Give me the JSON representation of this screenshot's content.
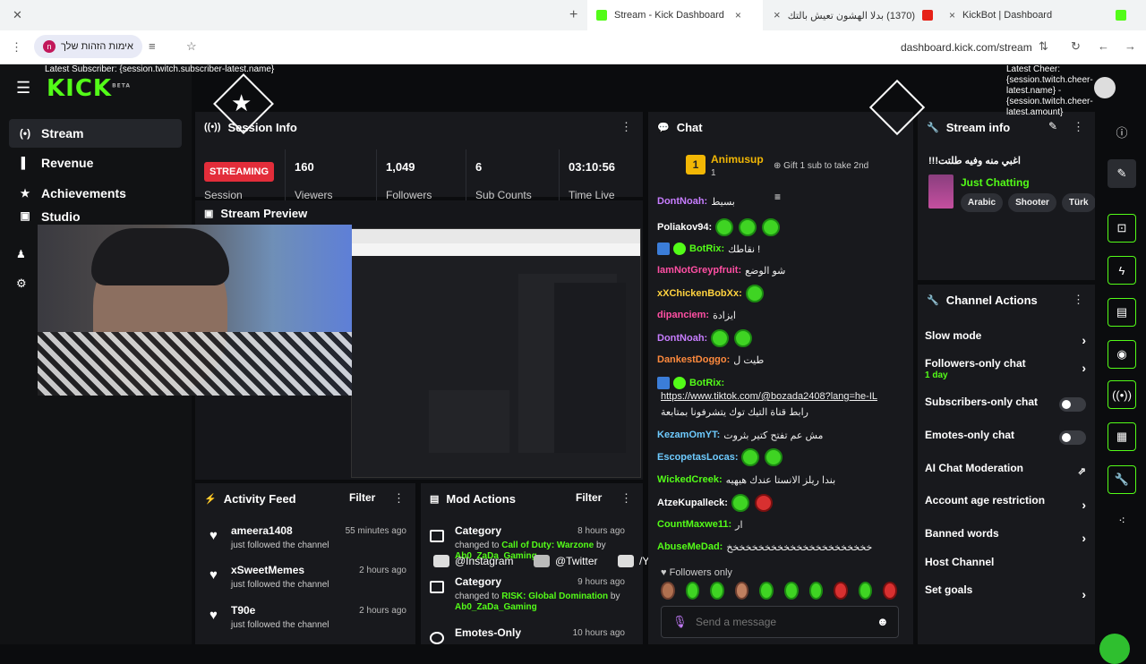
{
  "browser": {
    "tabs": [
      {
        "title": "",
        "close": "×"
      },
      {
        "title": "Stream - Kick Dashboard",
        "close": "×"
      },
      {
        "title": "(1370) بدلا الهشون تعيش بالتك",
        "close": "×"
      },
      {
        "title": "KickBot | Dashboard",
        "close": "×"
      }
    ],
    "new_tab": "+",
    "profile_label": "אימות הזהות שלך",
    "profile_initial": "n",
    "url": "dashboard.kick.com/stream"
  },
  "overlay": {
    "latest_subscriber": "Latest Subscriber: {session.twitch.subscriber-latest.name}",
    "latest_cheer": "Latest Cheer: {session.twitch.cheer-latest.name} - {session.twitch.cheer-latest.amount}",
    "socials": [
      "@Instagram",
      "@Twitter",
      "/YouTube"
    ]
  },
  "sidebar": {
    "logo": "KICK",
    "logo_beta": "BETA",
    "items": [
      {
        "label": "Stream",
        "icon": "stream-icon",
        "glyph": "(•)"
      },
      {
        "label": "Revenue",
        "icon": "revenue-icon",
        "glyph": "▌"
      },
      {
        "label": "Achievements",
        "icon": "trophy-icon",
        "glyph": "★"
      },
      {
        "label": "Studio",
        "icon": "studio-icon",
        "glyph": "▣"
      }
    ]
  },
  "session_info": {
    "title": "Session Info",
    "status": "STREAMING",
    "status_label": "Session",
    "stats": [
      {
        "value": "160",
        "label": "Viewers"
      },
      {
        "value": "1,049",
        "label": "Followers"
      },
      {
        "value": "6",
        "label": "Sub Counts"
      },
      {
        "value": "03:10:56",
        "label": "Time Live"
      }
    ]
  },
  "stream_preview": {
    "title": "Stream Preview"
  },
  "activity_feed": {
    "title": "Activity Feed",
    "filter": "Filter",
    "items": [
      {
        "user": "ameera1408",
        "action": "just followed the channel",
        "time": "55 minutes ago"
      },
      {
        "user": "xSweetMemes",
        "action": "just followed the channel",
        "time": "2 hours ago"
      },
      {
        "user": "T90e",
        "action": "just followed the channel",
        "time": "2 hours ago"
      }
    ]
  },
  "mod_actions": {
    "title": "Mod Actions",
    "filter": "Filter",
    "items": [
      {
        "title": "Category",
        "desc_prefix": "changed to ",
        "value": "Call of Duty: Warzone",
        "by": " by ",
        "user": "Ab0_ZaDa_Gaming",
        "time": "8 hours ago"
      },
      {
        "title": "Category",
        "desc_prefix": "changed to ",
        "value": "RISK: Global Domination",
        "by": " by ",
        "user": "Ab0_ZaDa_Gaming",
        "time": "9 hours ago"
      },
      {
        "title": "Emotes-Only",
        "desc_prefix": "",
        "value": "",
        "by": "",
        "user": "",
        "time": "10 hours ago"
      }
    ]
  },
  "chat": {
    "title": "Chat",
    "pinned_user": "Animusup",
    "pinned_count": "1",
    "gift_text": "Gift 1 sub to take 2nd",
    "messages": [
      {
        "user": "DontNoah:",
        "color": "#c77dff",
        "text": "بسيط"
      },
      {
        "user": "Poliakov94:",
        "color": "#ffffff",
        "text": "",
        "emotes": 3
      },
      {
        "user": "BotRix:",
        "color": "#53fc18",
        "text": "نقاطك !",
        "badges": true
      },
      {
        "user": "IamNotGreypfruit:",
        "color": "#ff4fa3",
        "text": "شو الوضع"
      },
      {
        "user": "xXChickenBobXx:",
        "color": "#ffd23f",
        "text": "",
        "emotes": 1
      },
      {
        "user": "dipanciem:",
        "color": "#ff4fa3",
        "text": "ايزادة"
      },
      {
        "user": "DontNoah:",
        "color": "#c77dff",
        "text": "",
        "emotes": 2
      },
      {
        "user": "DankestDoggo:",
        "color": "#ff8a3d",
        "text": "طيت ل"
      },
      {
        "user": "BotRix:",
        "color": "#53fc18",
        "text": "",
        "badges": true
      },
      {
        "user": "",
        "color": "#ffffff",
        "text": "https://www.tiktok.com/@bozada2408?lang=he-IL",
        "link": true
      },
      {
        "user": "",
        "color": "#ffffff",
        "text": "رابط قناة التيك توك يتشرفونا بمتابعة"
      },
      {
        "user": "KezamOmYT:",
        "color": "#6ecbff",
        "text": "مش عم تفتح كتير بثروت"
      },
      {
        "user": "EscopetasLocas:",
        "color": "#6ecbff",
        "text": "",
        "emotes": 2
      },
      {
        "user": "WickedCreek:",
        "color": "#53fc18",
        "text": "بندا ريلز الانستا عندك هيهيه"
      },
      {
        "user": "AtzeKupalleck:",
        "color": "#ffffff",
        "text": "",
        "emotes": 2
      },
      {
        "user": "CountMaxwe11:",
        "color": "#53fc18",
        "text": "ار"
      },
      {
        "user": "AbuseMeDad:",
        "color": "#53fc18",
        "text": "خخخخخخخخخخخخخخخخخخخخخخخ"
      }
    ],
    "followers_only": "Followers only",
    "input_placeholder": "Send a message"
  },
  "stream_info": {
    "title": "Stream info",
    "stream_title": "!!!اغبي منه وفيه طلتت",
    "category": "Just Chatting",
    "tags": [
      "Arabic",
      "Shooter",
      "Türk"
    ]
  },
  "channel_actions": {
    "title": "Channel Actions",
    "items": [
      {
        "label": "Slow mode",
        "kind": "chevron"
      },
      {
        "label": "Followers-only chat",
        "sub": "1 day",
        "kind": "chevron"
      },
      {
        "label": "Subscribers-only chat",
        "kind": "toggle"
      },
      {
        "label": "Emotes-only chat",
        "kind": "toggle"
      },
      {
        "label": "AI Chat Moderation",
        "kind": "external"
      },
      {
        "label": "Account age restriction",
        "kind": "chevron"
      },
      {
        "label": "Banned words",
        "kind": "chevron"
      },
      {
        "label": "Host Channel",
        "kind": "none"
      },
      {
        "label": "Set goals",
        "kind": "chevron"
      }
    ]
  },
  "colors": {
    "accent": "#53fc18",
    "live": "#e32d3a",
    "panel": "#18191d",
    "background": "#0b0c0e"
  }
}
